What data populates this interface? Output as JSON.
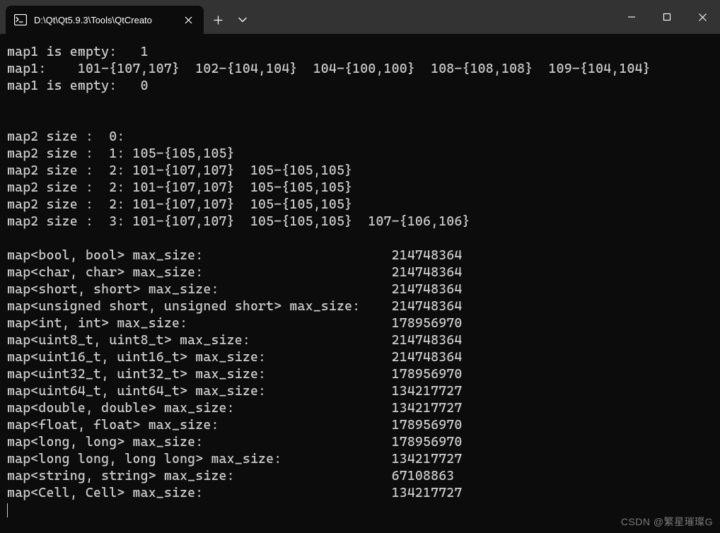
{
  "window": {
    "tab_title": "D:\\Qt\\Qt5.9.3\\Tools\\QtCreato"
  },
  "terminal_output": {
    "section1": [
      "map1 is empty:   1",
      "map1:    101-{107,107}  102-{104,104}  104-{100,100}  108-{108,108}  109-{104,104}",
      "map1 is empty:   0"
    ],
    "section2": [
      "map2 size :  0:",
      "map2 size :  1: 105-{105,105}",
      "map2 size :  2: 101-{107,107}  105-{105,105}",
      "map2 size :  2: 101-{107,107}  105-{105,105}",
      "map2 size :  2: 101-{107,107}  105-{105,105}",
      "map2 size :  3: 101-{107,107}  105-{105,105}  107-{106,106}"
    ],
    "section3": [
      {
        "label": "map<bool, bool> max_size:",
        "value": "214748364"
      },
      {
        "label": "map<char, char> max_size:",
        "value": "214748364"
      },
      {
        "label": "map<short, short> max_size:",
        "value": "214748364"
      },
      {
        "label": "map<unsigned short, unsigned short> max_size:",
        "value": "214748364"
      },
      {
        "label": "map<int, int> max_size:",
        "value": "178956970"
      },
      {
        "label": "map<uint8_t, uint8_t> max_size:",
        "value": "214748364"
      },
      {
        "label": "map<uint16_t, uint16_t> max_size:",
        "value": "214748364"
      },
      {
        "label": "map<uint32_t, uint32_t> max_size:",
        "value": "178956970"
      },
      {
        "label": "map<uint64_t, uint64_t> max_size:",
        "value": "134217727"
      },
      {
        "label": "map<double, double> max_size:",
        "value": "134217727"
      },
      {
        "label": "map<float, float> max_size:",
        "value": "178956970"
      },
      {
        "label": "map<long, long> max_size:",
        "value": "178956970"
      },
      {
        "label": "map<long long, long long> max_size:",
        "value": "134217727"
      },
      {
        "label": "map<string, string> max_size:",
        "value": "67108863"
      },
      {
        "label": "map<Cell, Cell> max_size:",
        "value": "134217727"
      }
    ],
    "label_column_width": 49
  },
  "watermark": "CSDN @繁星璀璨G"
}
